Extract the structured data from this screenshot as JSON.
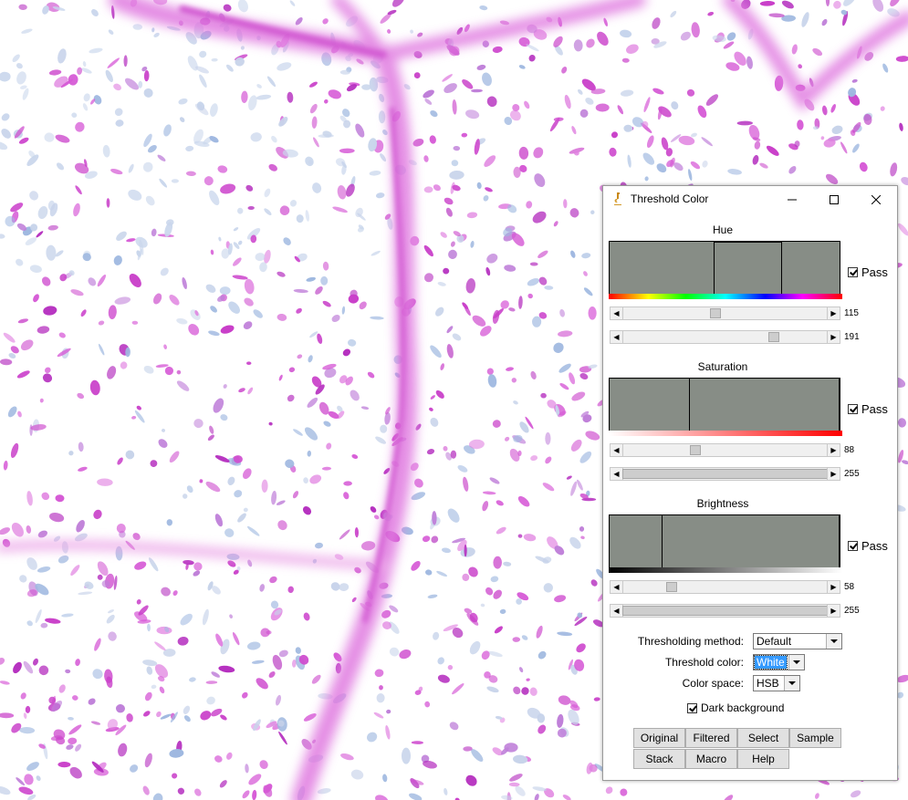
{
  "background": {
    "description_icon": "micrograph-tissue-image"
  },
  "window": {
    "title": "Threshold Color",
    "icon": "microscope-icon",
    "controls": [
      "minimize-icon",
      "maximize-icon",
      "close-icon"
    ]
  },
  "hue": {
    "label": "Hue",
    "pass_label": "Pass",
    "pass_checked": true,
    "min": "115",
    "max": "191",
    "min_value": 115,
    "max_value": 191
  },
  "saturation": {
    "label": "Saturation",
    "pass_label": "Pass",
    "pass_checked": true,
    "min": "88",
    "max": "255",
    "min_value": 88,
    "max_value": 255
  },
  "brightness": {
    "label": "Brightness",
    "pass_label": "Pass",
    "pass_checked": true,
    "min": "58",
    "max": "255",
    "min_value": 58,
    "max_value": 255
  },
  "options": {
    "method_label": "Thresholding method:",
    "method_value": "Default",
    "color_label": "Threshold color:",
    "color_value": "White",
    "space_label": "Color space:",
    "space_value": "HSB",
    "dark_bg_label": "Dark background",
    "dark_bg_checked": true
  },
  "buttons": {
    "original": "Original",
    "filtered": "Filtered",
    "select": "Select",
    "sample": "Sample",
    "stack": "Stack",
    "macro": "Macro",
    "help": "Help"
  },
  "colors": {
    "histogram_bg": "#878d86",
    "tissue_pink": "#cc44cc",
    "selection_blue": "#3399ff"
  }
}
